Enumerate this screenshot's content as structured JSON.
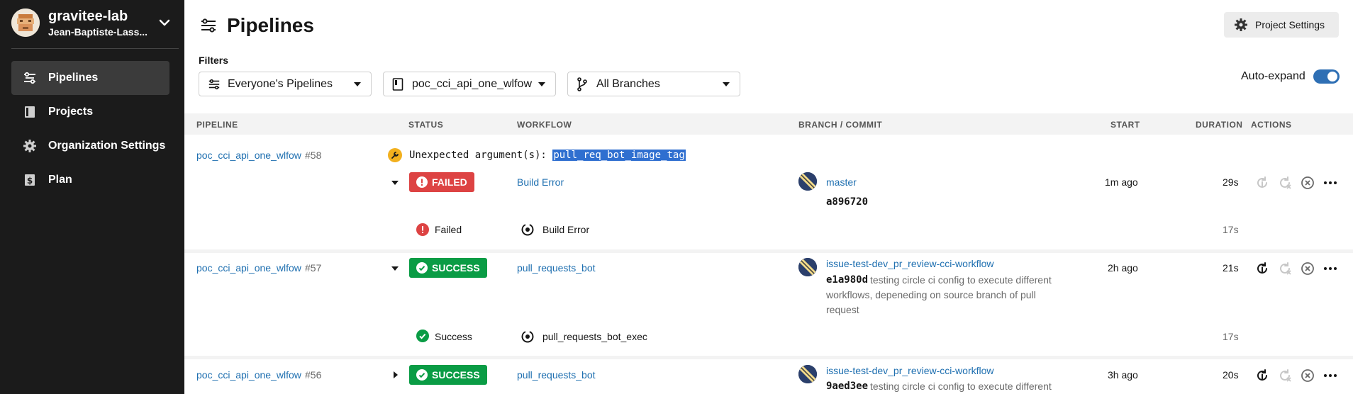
{
  "sidebar": {
    "org_name": "gravitee-lab",
    "user_name": "Jean-Baptiste-Lass...",
    "items": [
      {
        "label": "Pipelines",
        "icon": "pipelines-icon",
        "active": true
      },
      {
        "label": "Projects",
        "icon": "book-icon",
        "active": false
      },
      {
        "label": "Organization Settings",
        "icon": "gear-icon",
        "active": false
      },
      {
        "label": "Plan",
        "icon": "dollar-icon",
        "active": false
      }
    ]
  },
  "header": {
    "title": "Pipelines",
    "project_settings_label": "Project Settings"
  },
  "filters": {
    "label": "Filters",
    "pipelines_select": "Everyone's Pipelines",
    "project_select": "poc_cci_api_one_wlfow",
    "branch_select": "All Branches",
    "auto_expand_label": "Auto-expand",
    "auto_expand_on": true
  },
  "table": {
    "columns": {
      "pipeline": "PIPELINE",
      "status": "STATUS",
      "workflow": "WORKFLOW",
      "branch_commit": "BRANCH / COMMIT",
      "start": "START",
      "duration": "DURATION",
      "actions": "ACTIONS"
    },
    "rows": [
      {
        "project": "poc_cci_api_one_wlfow",
        "number": "#58",
        "error_prefix": "Unexpected argument(s):",
        "error_arg": "pull_req_bot_image_tag",
        "status": "FAILED",
        "workflow": "Build Error",
        "branch": "master",
        "commit_sha": "a896720",
        "commit_msg": "",
        "start": "1m ago",
        "duration": "29s",
        "job_status": "Failed",
        "job_name": "Build Error",
        "job_duration": "17s"
      },
      {
        "project": "poc_cci_api_one_wlfow",
        "number": "#57",
        "status": "SUCCESS",
        "workflow": "pull_requests_bot",
        "branch": "issue-test-dev_pr_review-cci-workflow",
        "commit_sha": "e1a980d",
        "commit_msg_1": "testing circle ci config to execute different",
        "commit_msg_2": "workflows, depeneding on source branch of pull",
        "commit_msg_3": "request",
        "start": "2h ago",
        "duration": "21s",
        "job_status": "Success",
        "job_name": "pull_requests_bot_exec",
        "job_duration": "17s"
      },
      {
        "project": "poc_cci_api_one_wlfow",
        "number": "#56",
        "status": "SUCCESS",
        "workflow": "pull_requests_bot",
        "branch": "issue-test-dev_pr_review-cci-workflow",
        "commit_sha": "9aed3ee",
        "commit_msg_1": "testing circle ci config to execute different",
        "start": "3h ago",
        "duration": "20s"
      }
    ]
  },
  "colors": {
    "sidebar_bg": "#1b1b1b",
    "link": "#1e6fb0",
    "failed": "#dd4343",
    "success": "#0a9c45",
    "toggle": "#2e6fb4"
  }
}
